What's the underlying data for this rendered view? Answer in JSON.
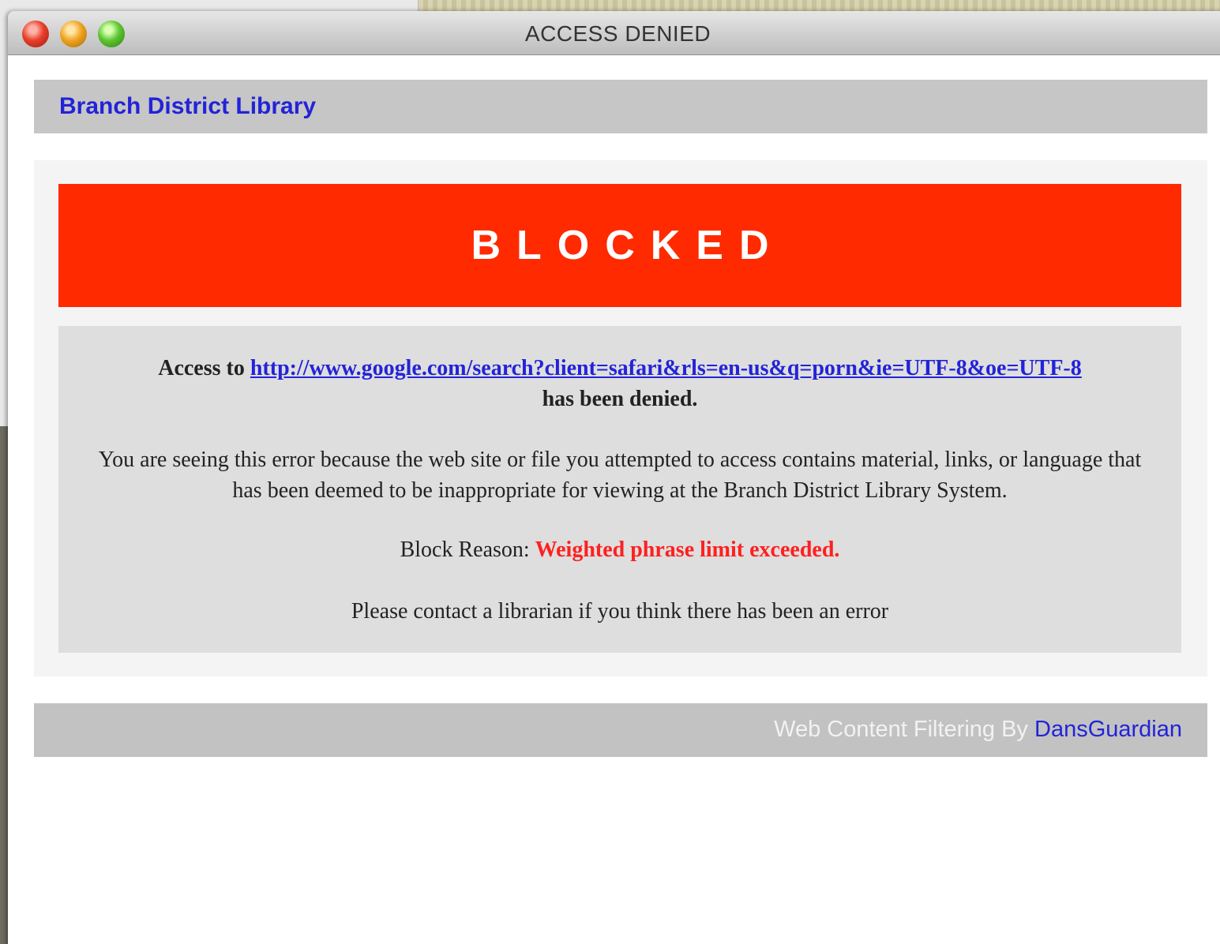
{
  "window": {
    "title": "ACCESS DENIED"
  },
  "header": {
    "library_name": "Branch District Library"
  },
  "banner": {
    "text": "BLOCKED",
    "color": "#ff2a00"
  },
  "message": {
    "access_prefix": "Access to",
    "blocked_url": "http://www.google.com/search?client=safari&rls=en-us&q=porn&ie=UTF-8&oe=UTF-8",
    "access_suffix": "has been denied.",
    "explanation": "You are seeing this error because the web site or file you attempted to access contains material, links, or language that has been deemed to be inappropriate for viewing at the Branch District Library System.",
    "reason_label": "Block Reason:",
    "reason_value": "Weighted phrase limit exceeded.",
    "contact": "Please contact a librarian if you think there has been an error"
  },
  "footer": {
    "prefix": "Web Content Filtering By",
    "link": "DansGuardian"
  },
  "colors": {
    "link": "#2323d8",
    "reason": "#ff2020"
  }
}
